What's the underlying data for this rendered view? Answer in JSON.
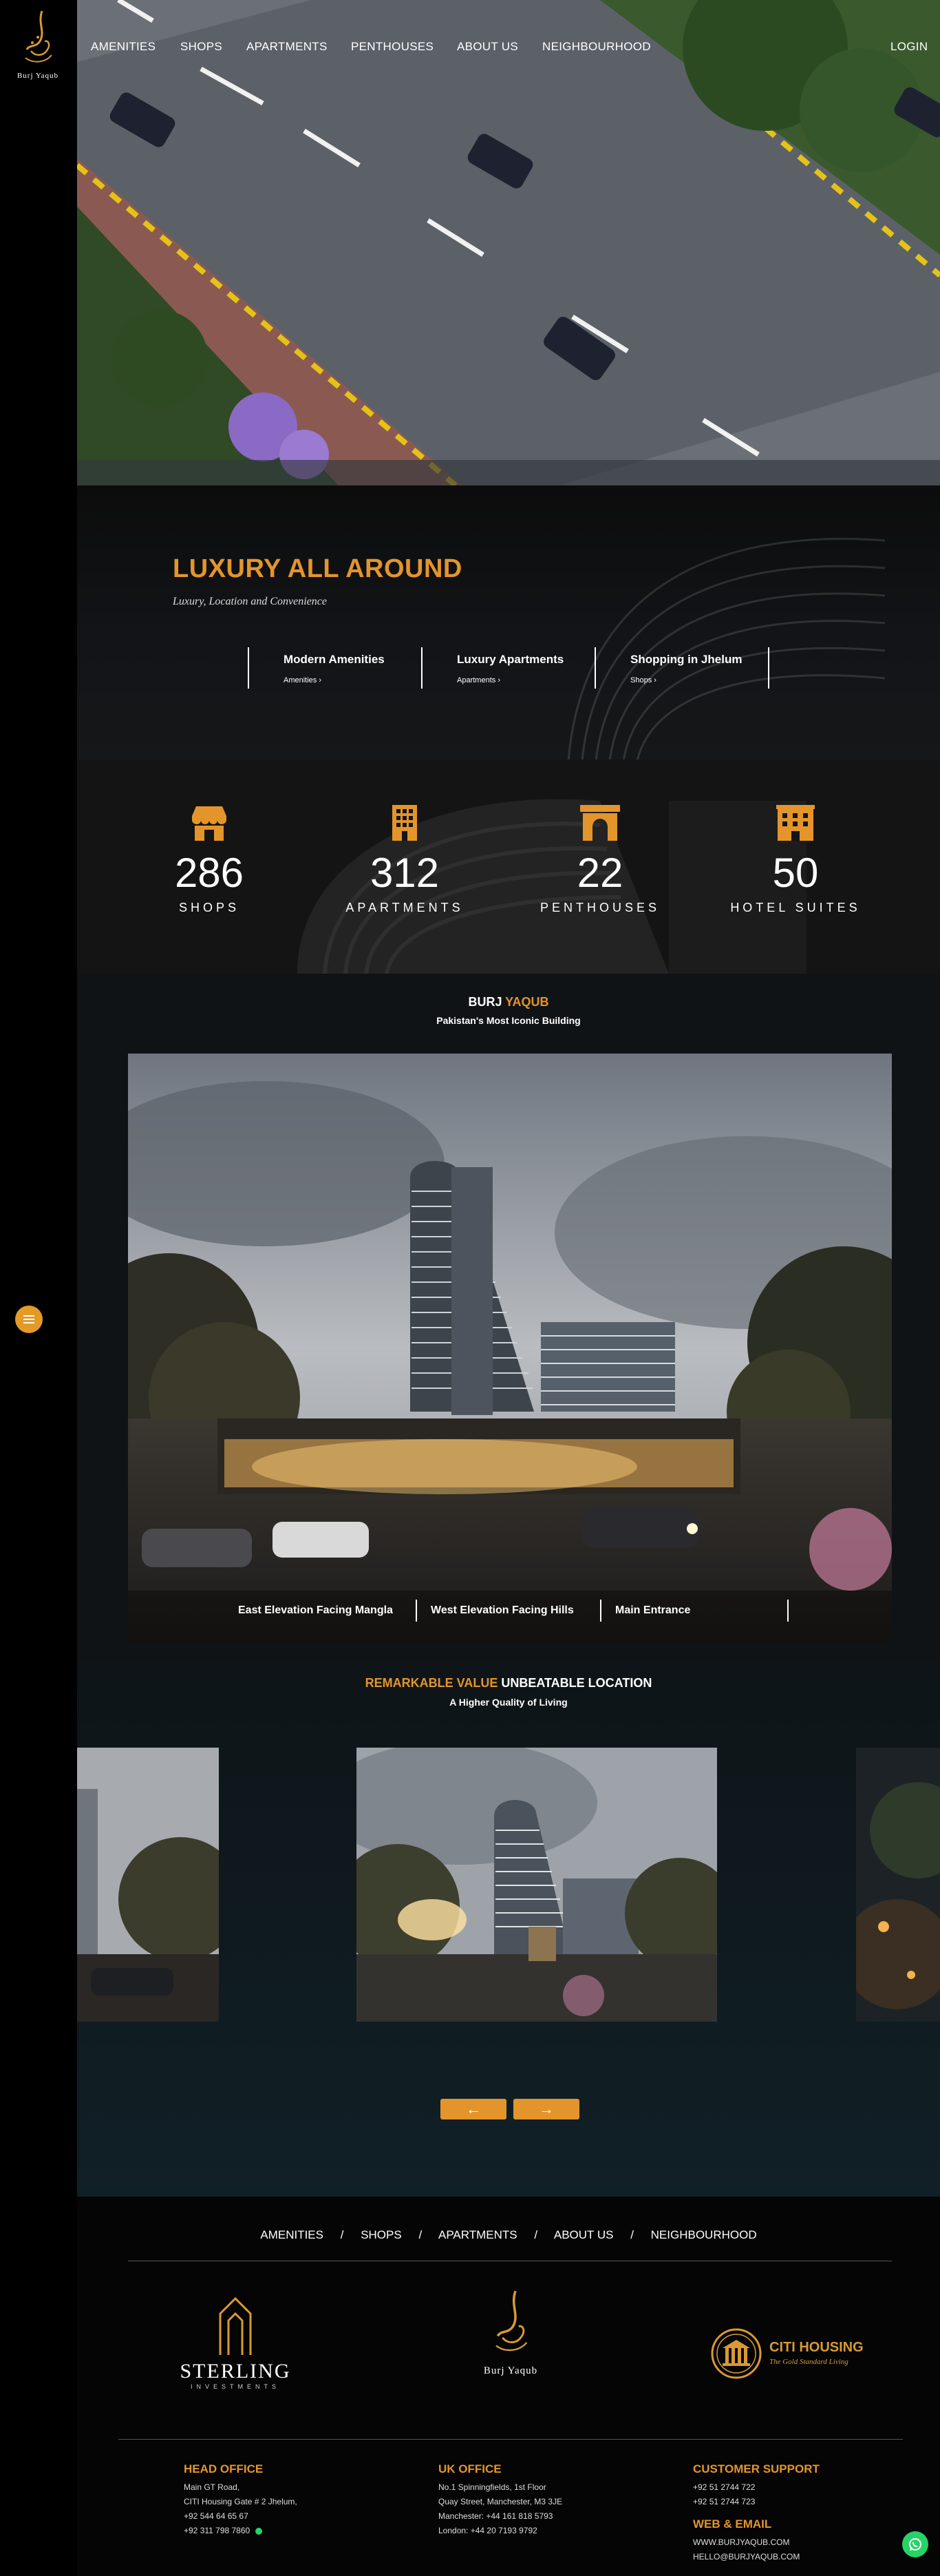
{
  "brand": {
    "wordmark": "Burj Yaqub"
  },
  "nav": {
    "items": [
      "AMENITIES",
      "SHOPS",
      "APARTMENTS",
      "PENTHOUSES",
      "ABOUT US",
      "NEIGHBOURHOOD"
    ],
    "login": "LOGIN"
  },
  "luxury": {
    "title": "LUXURY ALL AROUND",
    "subtitle": "Luxury, Location and Convenience",
    "items": [
      {
        "title": "Modern Amenities",
        "link": "Amenities"
      },
      {
        "title": "Luxury Apartments",
        "link": "Apartments"
      },
      {
        "title": "Shopping in Jhelum",
        "link": "Shops"
      }
    ]
  },
  "stats": [
    {
      "value": "286",
      "label": "SHOPS",
      "icon": "shop-icon"
    },
    {
      "value": "312",
      "label": "APARTMENTS",
      "icon": "building-icon"
    },
    {
      "value": "22",
      "label": "PENTHOUSES",
      "icon": "arch-icon"
    },
    {
      "value": "50",
      "label": "HOTEL SUITES",
      "icon": "hotel-icon"
    }
  ],
  "burj": {
    "title_a": "BURJ",
    "title_b": "YAQUB",
    "subtitle": "Pakistan's Most Iconic Building",
    "captions": [
      "East Elevation Facing Mangla",
      "West Elevation Facing Hills",
      "Main Entrance"
    ]
  },
  "gallery": {
    "title_a": "REMARKABLE VALUE",
    "title_b": "UNBEATABLE LOCATION",
    "subtitle": "A Higher Quality of Living",
    "prev": "←",
    "next": "→"
  },
  "footer": {
    "nav": [
      "AMENITIES",
      "SHOPS",
      "APARTMENTS",
      "ABOUT US",
      "NEIGHBOURHOOD"
    ],
    "nav_sep": "/",
    "logos": {
      "sterling": "STERLING",
      "sterling_sub": "INVESTMENTS",
      "burj": "Burj Yaqub",
      "citi": "CITI HOUSING",
      "citi_sub": "The Gold Standard Living"
    },
    "head_office": {
      "title": "HEAD OFFICE",
      "lines": [
        "Main GT Road,",
        "CITI Housing Gate # 2 Jhelum,",
        "+92 544 64 65 67",
        "+92 311 798 7860"
      ]
    },
    "uk_office": {
      "title": "UK OFFICE",
      "lines": [
        "No.1 Spinningfields, 1st Floor",
        "Quay Street, Manchester, M3 3JE",
        "Manchester: +44 161 818 5793",
        "London: +44 20 7193 9792"
      ]
    },
    "support": {
      "title": "CUSTOMER SUPPORT",
      "lines": [
        "+92 51 2744 722",
        "+92 51 2744 723"
      ]
    },
    "web": {
      "title": "WEB & EMAIL",
      "lines": [
        "WWW.BURJYAQUB.COM",
        "HELLO@BURJYAQUB.COM"
      ]
    }
  },
  "colors": {
    "accent": "#e3952c",
    "rail": "#d89a33",
    "background": "#000000"
  }
}
